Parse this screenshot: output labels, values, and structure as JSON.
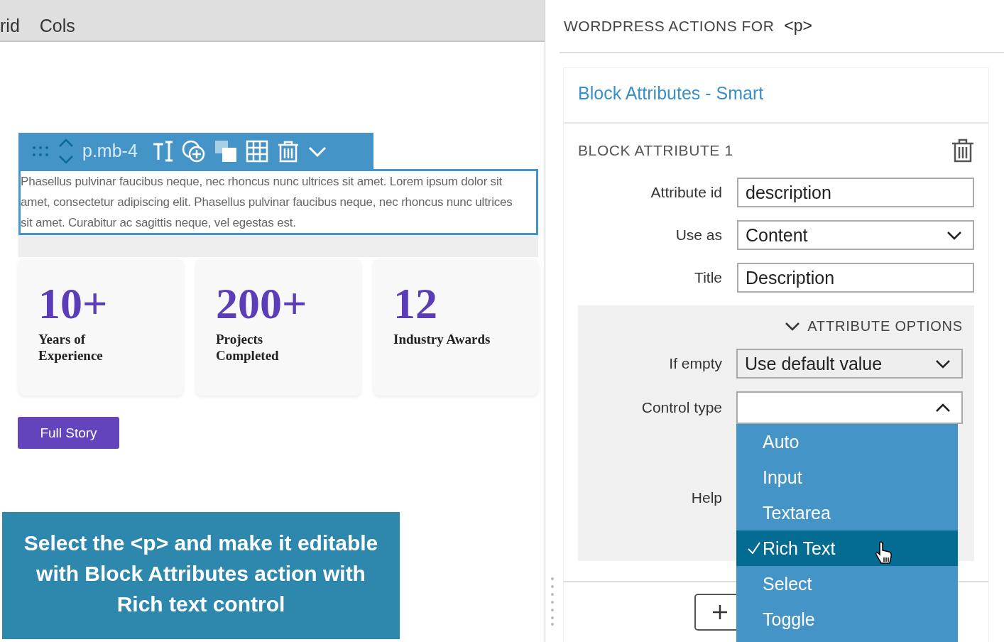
{
  "top_menu": [
    {
      "label": "rid"
    },
    {
      "label": "Cols"
    }
  ],
  "canvas": {
    "toolbar": {
      "selector": "p.mb-4"
    },
    "paragraph": "Phasellus pulvinar faucibus neque, nec rhoncus nunc ultrices sit amet. Lorem ipsum dolor sit amet, consectetur adipiscing elit. Phasellus pulvinar faucibus neque, nec rhoncus nunc ultrices sit amet. Curabitur ac sagittis neque, vel egestas est.",
    "stats": [
      {
        "number": "10+",
        "label": "Years of Experience"
      },
      {
        "number": "200+",
        "label": "Projects Completed"
      },
      {
        "number": "12",
        "label": "Industry Awards"
      }
    ],
    "button": "Full Story"
  },
  "caption": "Select the <p> and make it editable with Block Attributes action with Rich text control",
  "panel": {
    "header": "WORDPRESS ACTIONS FOR",
    "tag": "<p>",
    "card_title": "Block Attributes - Smart",
    "section": "BLOCK ATTRIBUTE 1",
    "fields": [
      {
        "label": "Attribute id",
        "value": "description",
        "kind": "input"
      },
      {
        "label": "Use as",
        "value": "Content",
        "kind": "select"
      },
      {
        "label": "Title",
        "value": "Description",
        "kind": "input"
      }
    ],
    "options": {
      "title": "ATTRIBUTE OPTIONS",
      "expanded": true,
      "if_empty": {
        "label": "If empty",
        "value": "Use default value"
      },
      "control_type": {
        "label": "Control type",
        "open": true,
        "options": [
          {
            "label": "Auto",
            "selected": false
          },
          {
            "label": "Input",
            "selected": false
          },
          {
            "label": "Textarea",
            "selected": false
          },
          {
            "label": "Rich Text",
            "selected": true
          },
          {
            "label": "Select",
            "selected": false
          },
          {
            "label": "Toggle",
            "selected": false
          }
        ]
      },
      "help_label": "Help"
    }
  }
}
